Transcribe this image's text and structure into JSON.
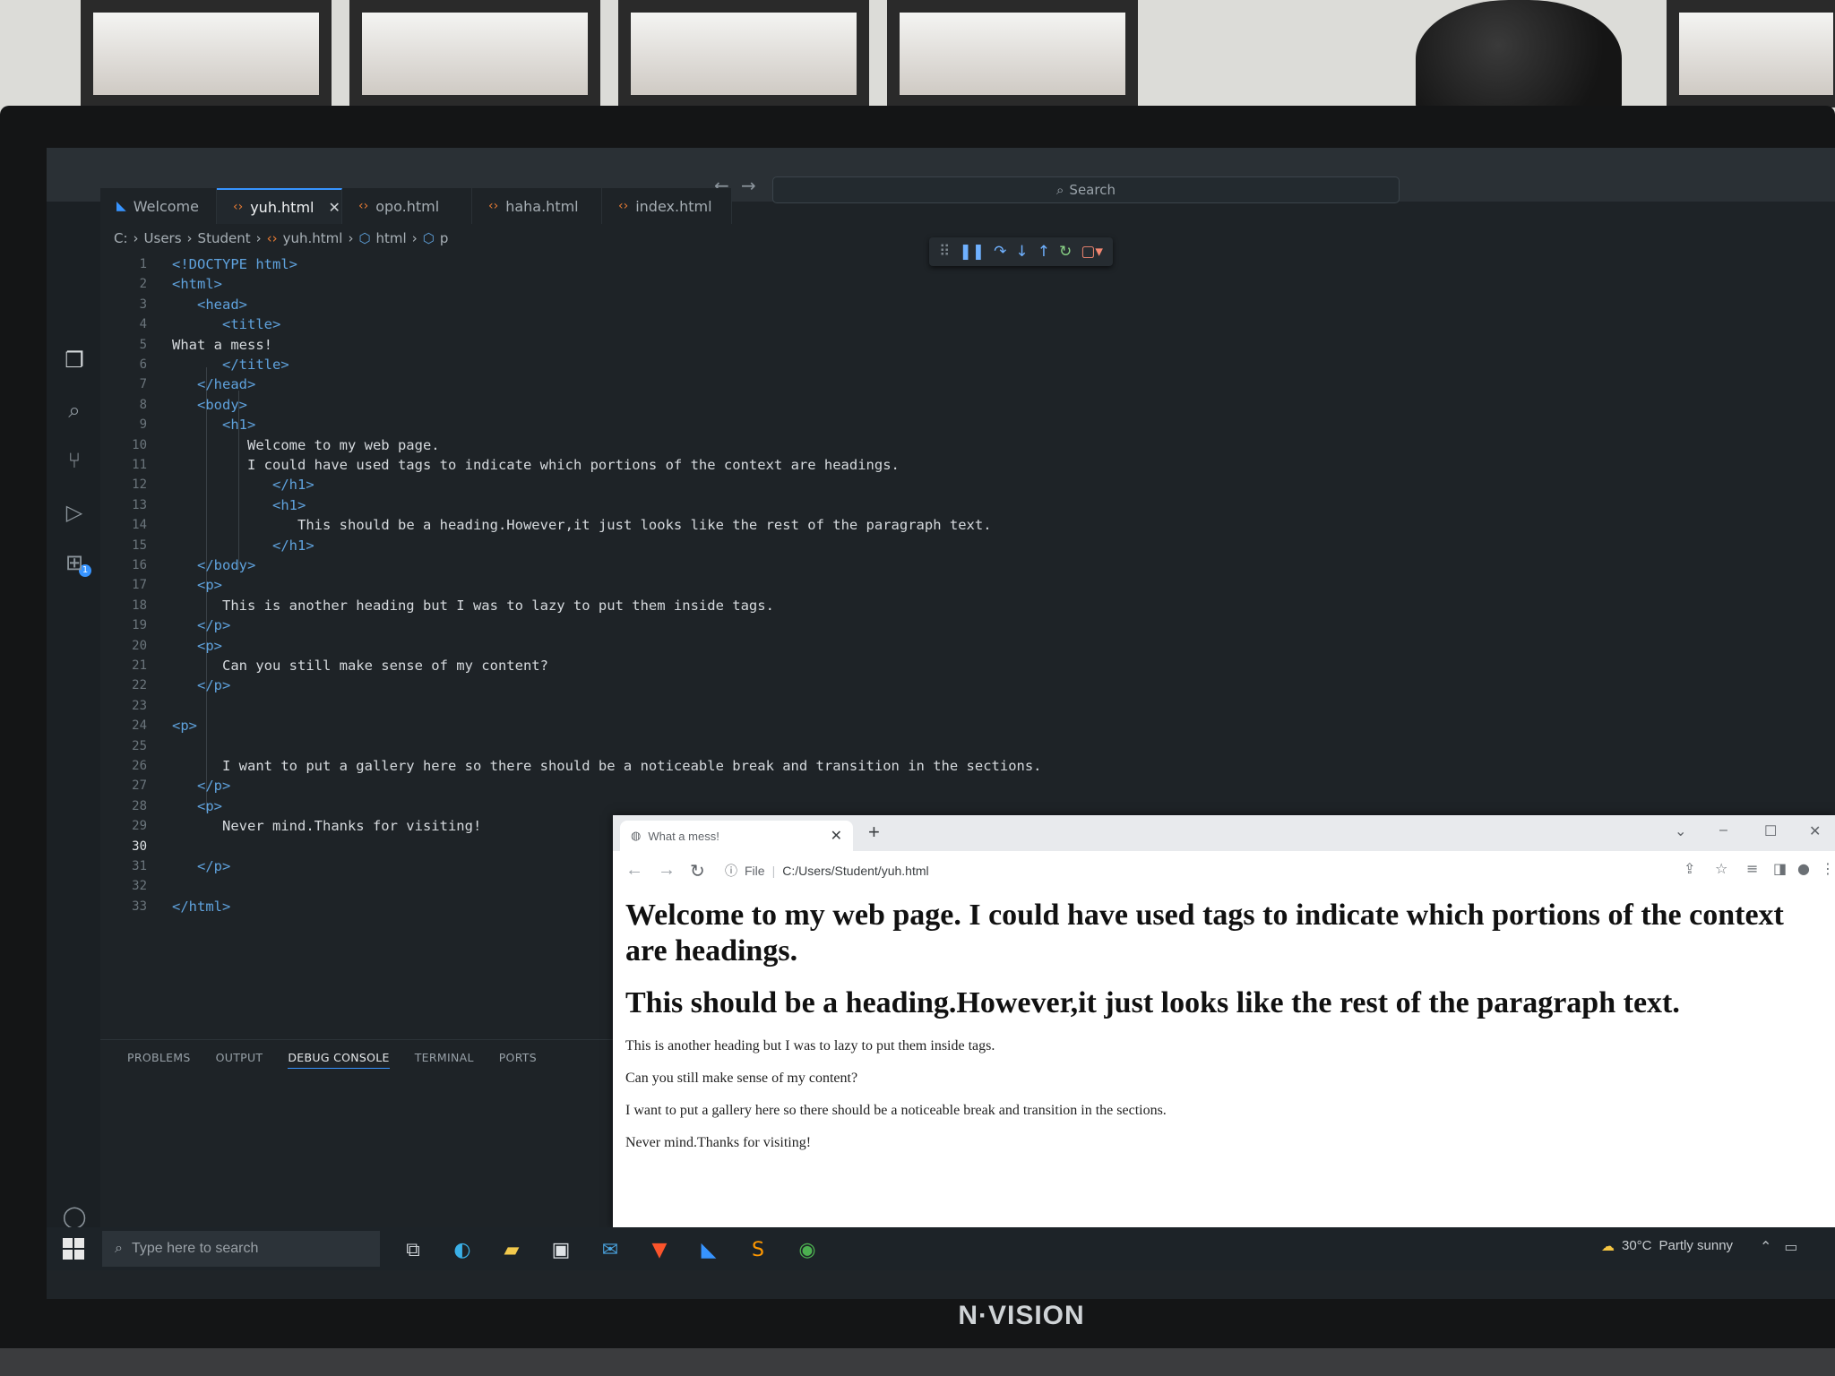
{
  "monitor": {
    "brand": "N·VISION"
  },
  "vscode": {
    "search_placeholder": "Search",
    "tabs": [
      {
        "label": "Welcome",
        "icon": "vscode-icon"
      },
      {
        "label": "yuh.html",
        "icon": "html-file-icon",
        "active": true,
        "close": "✕"
      },
      {
        "label": "opo.html",
        "icon": "html-file-icon"
      },
      {
        "label": "haha.html",
        "icon": "html-file-icon"
      },
      {
        "label": "index.html",
        "icon": "html-file-icon"
      }
    ],
    "breadcrumb": [
      "C:",
      "Users",
      "Student",
      "yuh.html",
      "html",
      "p"
    ],
    "current_line": "30",
    "code_lines": [
      {
        "n": "1",
        "text": "<!DOCTYPE html>",
        "kind": "doc"
      },
      {
        "n": "2",
        "text": "<html>",
        "kind": "tag"
      },
      {
        "n": "3",
        "text": "<head>",
        "kind": "tag"
      },
      {
        "n": "4",
        "text": "<title>",
        "kind": "tag"
      },
      {
        "n": "5",
        "text": "What a mess!",
        "kind": "text"
      },
      {
        "n": "6",
        "text": "</title>",
        "kind": "tag"
      },
      {
        "n": "7",
        "text": "</head>",
        "kind": "tag"
      },
      {
        "n": "8",
        "text": "<body>",
        "kind": "tag"
      },
      {
        "n": "9",
        "text": "<h1>",
        "kind": "tag"
      },
      {
        "n": "10",
        "text": "Welcome to my web page.",
        "kind": "text"
      },
      {
        "n": "11",
        "text": "I could have used tags to indicate which portions of the context are headings.",
        "kind": "text"
      },
      {
        "n": "12",
        "text": "</h1>",
        "kind": "tag"
      },
      {
        "n": "13",
        "text": "<h1>",
        "kind": "tag"
      },
      {
        "n": "14",
        "text": "This should be a heading.However,it just looks like the rest of the paragraph text.",
        "kind": "text"
      },
      {
        "n": "15",
        "text": "</h1>",
        "kind": "tag"
      },
      {
        "n": "16",
        "text": "</body>",
        "kind": "tag"
      },
      {
        "n": "17",
        "text": "<p>",
        "kind": "tag"
      },
      {
        "n": "18",
        "text": "This is another heading but I was to lazy to put them inside tags.",
        "kind": "text"
      },
      {
        "n": "19",
        "text": "</p>",
        "kind": "tag"
      },
      {
        "n": "20",
        "text": "<p>",
        "kind": "tag"
      },
      {
        "n": "21",
        "text": "Can you still make sense of my content?",
        "kind": "text"
      },
      {
        "n": "22",
        "text": "</p>",
        "kind": "tag"
      },
      {
        "n": "23",
        "text": "",
        "kind": "text"
      },
      {
        "n": "24",
        "text": "<p>",
        "kind": "tag"
      },
      {
        "n": "25",
        "text": "",
        "kind": "text"
      },
      {
        "n": "26",
        "text": "I want to put a gallery here so there should be a noticeable break and transition in the sections.",
        "kind": "text"
      },
      {
        "n": "27",
        "text": "</p>",
        "kind": "tag"
      },
      {
        "n": "28",
        "text": "<p>",
        "kind": "tag"
      },
      {
        "n": "29",
        "text": "Never mind.Thanks for visiting!",
        "kind": "text"
      },
      {
        "n": "30",
        "text": "",
        "kind": "text"
      },
      {
        "n": "31",
        "text": "</p>",
        "kind": "tag"
      },
      {
        "n": "32",
        "text": "",
        "kind": "text"
      },
      {
        "n": "33",
        "text": "</html>",
        "kind": "tag"
      }
    ],
    "panel_tabs": [
      {
        "label": "PROBLEMS"
      },
      {
        "label": "OUTPUT"
      },
      {
        "label": "DEBUG CONSOLE",
        "active": true
      },
      {
        "label": "TERMINAL"
      },
      {
        "label": "PORTS"
      }
    ],
    "debug_badge": "1"
  },
  "browser": {
    "tab_title": "What a mess!",
    "new_tab": "+",
    "omnibox_scheme": "File",
    "omnibox_url": "C:/Users/Student/yuh.html",
    "content": {
      "h1_1": "Welcome to my web page. I could have used tags to indicate which portions of the context are headings.",
      "h1_2": "This should be a heading.However,it just looks like the rest of the paragraph text.",
      "p1": "This is another heading but I was to lazy to put them inside tags.",
      "p2": "Can you still make sense of my content?",
      "p3": "I want to put a gallery here so there should be a noticeable break and transition in the sections.",
      "p4": "Never mind.Thanks for visiting!"
    }
  },
  "taskbar": {
    "search_placeholder": "Type here to search",
    "apps": [
      "task-view-icon",
      "edge-icon",
      "file-explorer-icon",
      "store-icon",
      "mail-icon",
      "brave-icon",
      "vscode-icon",
      "sublime-icon",
      "chrome-icon"
    ],
    "weather_temp": "30°C",
    "weather_desc": "Partly sunny"
  }
}
